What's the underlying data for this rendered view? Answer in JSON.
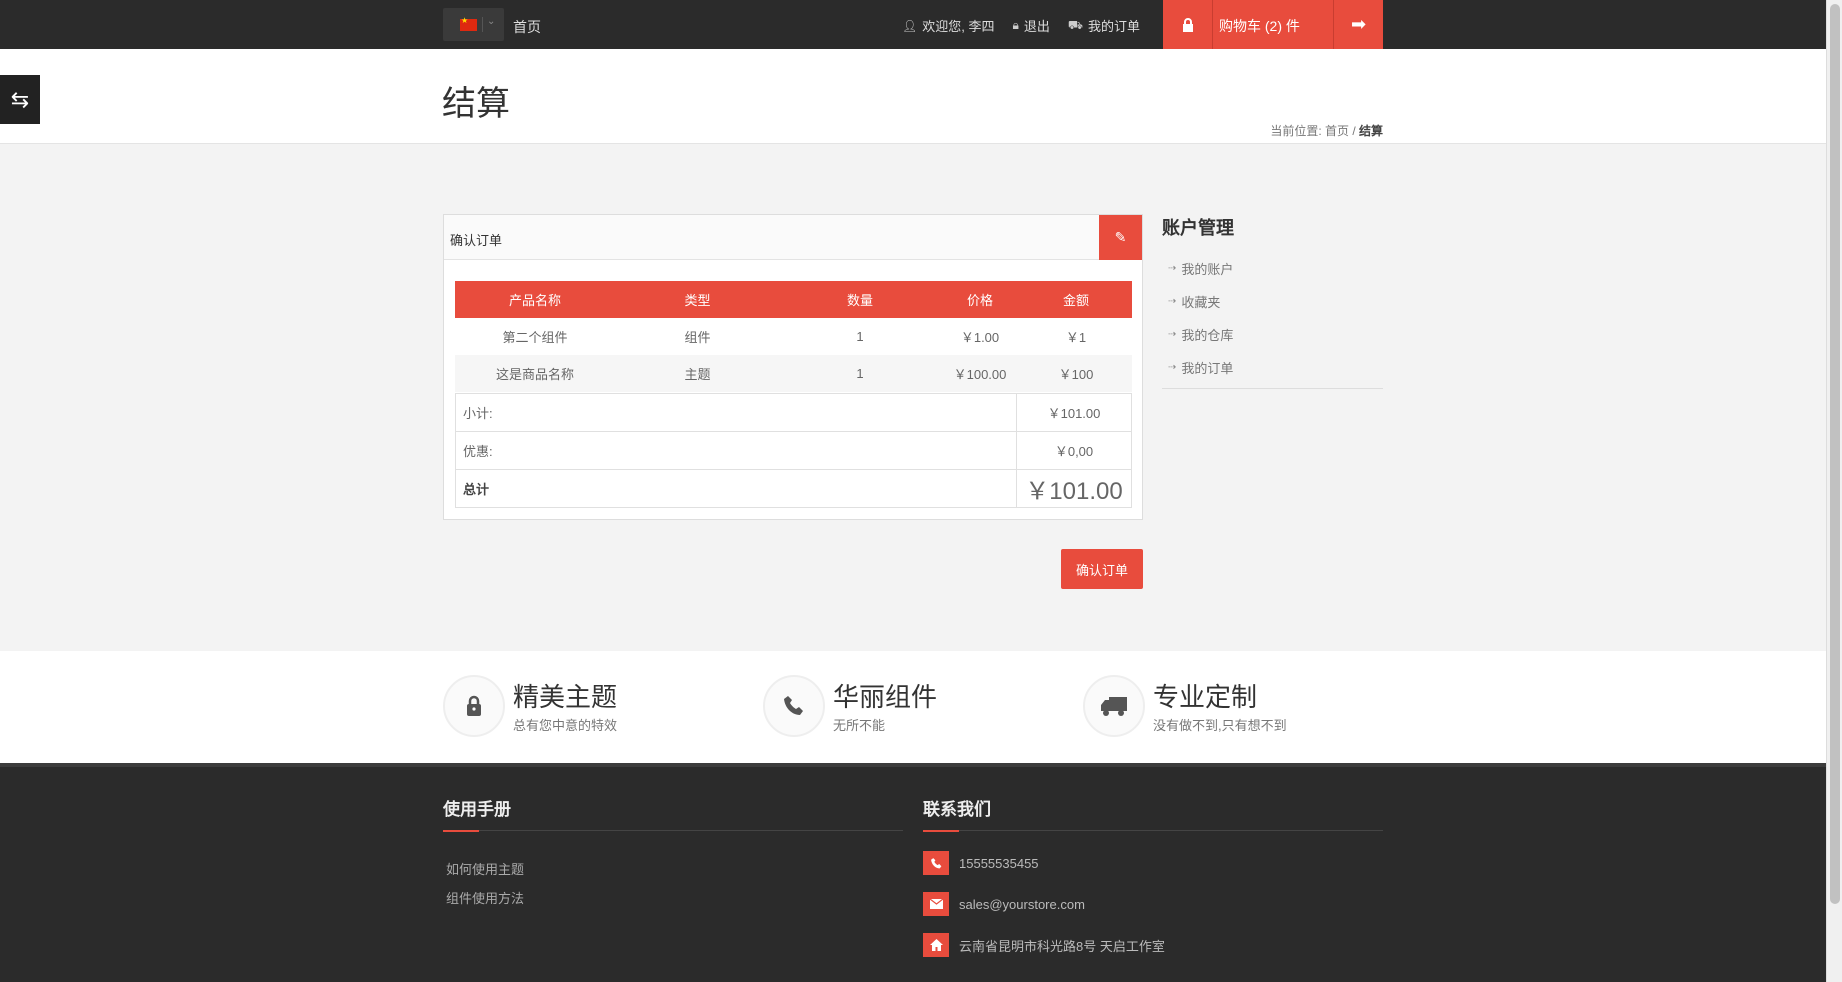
{
  "topbar": {
    "home": "首页",
    "welcome": "欢迎您, 李四",
    "logout": "退出",
    "my_orders": "我的订单",
    "cart": "购物车 (2) 件"
  },
  "header": {
    "title": "结算",
    "breadcrumb_prefix": "当前位置: 首页 / ",
    "breadcrumb_current": "结算"
  },
  "order": {
    "panel_title": "确认订单",
    "columns": [
      "产品名称",
      "类型",
      "数量",
      "价格",
      "金额"
    ],
    "rows": [
      [
        "第二个组件",
        "组件",
        "1",
        "￥1.00",
        "￥1"
      ],
      [
        "这是商品名称",
        "主题",
        "1",
        "￥100.00",
        "￥100"
      ]
    ],
    "subtotal_label": "小计:",
    "subtotal_value": "￥101.00",
    "discount_label": "优惠:",
    "discount_value": "￥0,00",
    "total_label": "总计",
    "total_value": "￥101.00",
    "confirm_button": "确认订单"
  },
  "sidebar": {
    "title": "账户管理",
    "items": [
      "我的账户",
      "收藏夹",
      "我的仓库",
      "我的订单"
    ]
  },
  "features": [
    {
      "title": "精美主题",
      "subtitle": "总有您中意的特效",
      "icon": "lock-icon"
    },
    {
      "title": "华丽组件",
      "subtitle": "无所不能",
      "icon": "phone-icon"
    },
    {
      "title": "专业定制",
      "subtitle": "没有做不到,只有想不到",
      "icon": "truck-icon"
    }
  ],
  "footer": {
    "manual_title": "使用手册",
    "manual_links": [
      "如何使用主题",
      "组件使用方法"
    ],
    "contact_title": "联系我们",
    "phone": "15555535455",
    "email": "sales@yourstore.com",
    "address": "云南省昆明市科光路8号 天启工作室"
  },
  "colors": {
    "accent": "#e84c3d",
    "dark": "#2b2b2b"
  }
}
